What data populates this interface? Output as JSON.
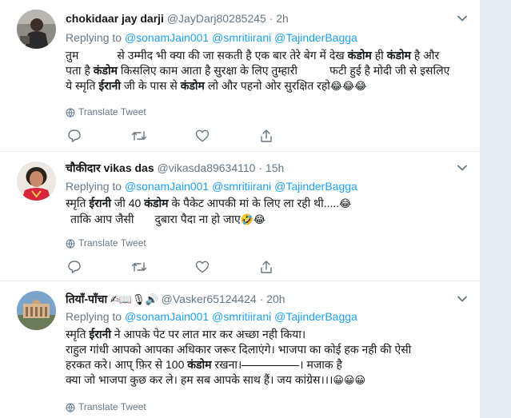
{
  "tweets": [
    {
      "name": "chokidaar jay darji",
      "handle": "@JayDarj80285245",
      "time": "2h",
      "replying_to": "Replying to",
      "mentions": [
        "@sonamJain001",
        "@smritiirani",
        "@TajinderBagga"
      ],
      "lines": [
        {
          "pre": "तुम",
          "b1": "",
          "mid1": "से उम्मीद भी क्या की जा सकती है एक बार तेरे बेग में देख ",
          "bold1": "कंडोम",
          "mid2": " ही ",
          "bold2": "कंडोम",
          "post": " है और"
        },
        {
          "pre": "पता है ",
          "bold1": "कंडोम",
          "mid1": " किसलिए काम आता है सुरक्षा के लिए तुम्हारी",
          "mid2": "फटी हुई है मोदी जी से इसलिए"
        },
        {
          "pre": "ये स्मृति ",
          "bold1": "ईरानी",
          "mid1": " जी के पास से ",
          "bold2": "कंडोम",
          "post": " लो और पहनो ओर सुरक्षित रहो"
        }
      ],
      "emojis": "😂😂😂",
      "translate": "Translate Tweet"
    },
    {
      "name": "चौकीदार vikas das",
      "handle": "@vikasda89634110",
      "time": "15h",
      "replying_to": "Replying to",
      "mentions": [
        "@sonamJain001",
        "@smritiirani",
        "@TajinderBagga"
      ],
      "line1_pre": "स्मृति ",
      "line1_bold1": "ईरानी",
      "line1_mid": " जी 40 ",
      "line1_bold2": "कंडोम",
      "line1_post": " के पैकेट आपकी मां के लिए ला रही थी.....",
      "line1_emoji": "😂",
      "line2_pre": "ताकि आप जैसी",
      "line2_post": "दुबारा पैदा ना हो जाए",
      "line2_emoji": "🤣😂",
      "translate": "Translate Tweet"
    },
    {
      "name": "तियाँ-पाँचा",
      "name_icons": "✍📖🎙🔊",
      "handle": "@Vasker65124424",
      "time": "20h",
      "replying_to": "Replying to",
      "mentions": [
        "@sonamJain001",
        "@smritiirani",
        "@TajinderBagga"
      ],
      "line1_pre": "स्मृति ",
      "line1_bold": "ईरानी",
      "line1_post": " ने आपके पेट पर लात मार कर अच्छा नही किया।",
      "line2": "राहुल गांधी आपको आपका अधिकार जरूर दिलाएंगे। भाजपा का कोई हक नही की ऐसी",
      "line3_pre": "हरकत करे। आप् फ़िर से 100 ",
      "line3_bold": "कंडोम",
      "line3_mid": " रखना।",
      "line3_post": "। मजाक है",
      "line4": "क्या जो भाजपा कुछ कर ले। हम सब आपके साथ हैं। जय कांग्रेस।।।",
      "line4_emoji": "😀😀😀",
      "translate": "Translate Tweet"
    }
  ],
  "colors": {
    "link": "#1da1f2",
    "secondary": "#657786",
    "text": "#14171a",
    "background": "#e6ecf0"
  }
}
